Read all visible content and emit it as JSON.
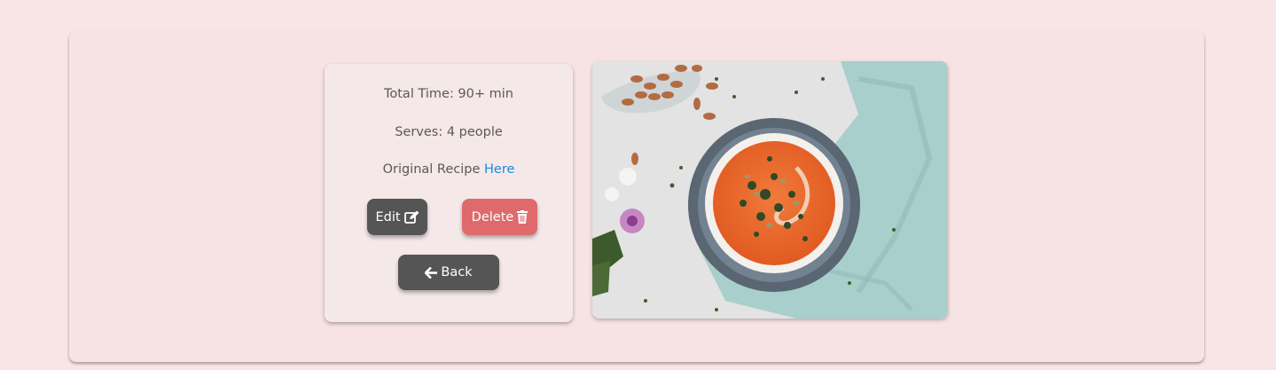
{
  "recipe": {
    "total_time_label": "Total Time: 90+ min",
    "serves_label": "Serves: 4 people",
    "original_recipe_text": "Original Recipe",
    "original_recipe_link": "Here"
  },
  "actions": {
    "edit_label": "Edit",
    "delete_label": "Delete",
    "back_label": "Back"
  },
  "icons": {
    "edit": "edit-icon",
    "delete": "trash-icon",
    "back": "arrow-left-icon"
  },
  "colors": {
    "page_background": "#f8e6e7",
    "card_background": "#f5e8e9",
    "text": "#5b5b4a",
    "link": "#1a8ad9",
    "dark_button": "#555555",
    "delete_button": "#de6a6c"
  }
}
